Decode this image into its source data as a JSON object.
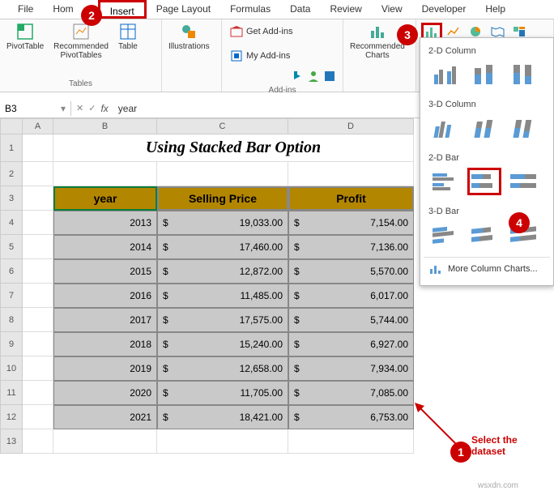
{
  "tabs": {
    "file": "File",
    "home": "Hom",
    "insert": "Insert",
    "page_layout": "Page Layout",
    "formulas": "Formulas",
    "data": "Data",
    "review": "Review",
    "view": "View",
    "developer": "Developer",
    "help": "Help"
  },
  "ribbon": {
    "tables_group": "Tables",
    "addins_group": "Add-ins",
    "pivottable": "PivotTable",
    "recommended_pivot": "Recommended\nPivotTables",
    "table": "Table",
    "illustrations": "Illustrations",
    "get_addins": "Get Add-ins",
    "my_addins": "My Add-ins",
    "recommended_charts": "Recommended\nCharts"
  },
  "name_box": "B3",
  "formula_value": "year",
  "columns": [
    "A",
    "B",
    "C",
    "D"
  ],
  "title": "Using Stacked Bar Option",
  "headers": {
    "year": "year",
    "selling": "Selling Price",
    "profit": "Profit"
  },
  "rows": [
    {
      "year": "2013",
      "selling": "19,033.00",
      "profit": "7,154.00"
    },
    {
      "year": "2014",
      "selling": "17,460.00",
      "profit": "7,136.00"
    },
    {
      "year": "2015",
      "selling": "12,872.00",
      "profit": "5,570.00"
    },
    {
      "year": "2016",
      "selling": "11,485.00",
      "profit": "6,017.00"
    },
    {
      "year": "2017",
      "selling": "17,575.00",
      "profit": "5,744.00"
    },
    {
      "year": "2018",
      "selling": "15,240.00",
      "profit": "6,927.00"
    },
    {
      "year": "2019",
      "selling": "12,658.00",
      "profit": "7,934.00"
    },
    {
      "year": "2020",
      "selling": "11,705.00",
      "profit": "7,085.00"
    },
    {
      "year": "2021",
      "selling": "18,421.00",
      "profit": "6,753.00"
    }
  ],
  "currency": "$",
  "dropdown": {
    "col2d": "2-D Column",
    "col3d": "3-D Column",
    "bar2d": "2-D Bar",
    "bar3d": "3-D Bar",
    "more": "More Column Charts..."
  },
  "annotations": {
    "select_dataset": "Select the\ndataset",
    "b1": "1",
    "b2": "2",
    "b3": "3",
    "b4": "4"
  },
  "watermark": "wsxdn.com"
}
